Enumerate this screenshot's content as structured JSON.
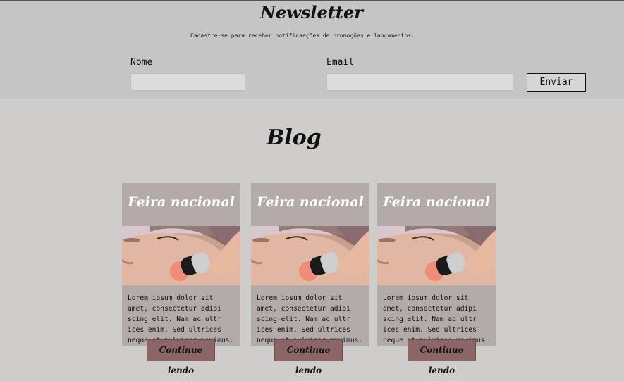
{
  "newsletter": {
    "title": "Newsletter",
    "subtitle": "Cadastre-se para receber notificaações de promoções e lançamentos.",
    "name_label": "Nome",
    "email_label": "Email",
    "name_value": "",
    "email_value": "",
    "submit_label": "Enviar"
  },
  "blog": {
    "title": "Blog",
    "posts": [
      {
        "title": "Feira nacional",
        "text": "Lorem ipsum dolor sit\namet, consectetur adipi\nscing elit. Nam ac ultr\nices enim. Sed ultrices\nneque et pulvinar maximus.",
        "image": "facial-treatment-photo",
        "button": "Continue lendo"
      },
      {
        "title": "Feira nacional",
        "text": "Lorem ipsum dolor sit\namet, consectetur adipi\nscing elit. Nam ac ultr\nices enim. Sed ultrices\nneque et pulvinar maximus.",
        "image": "facial-treatment-photo",
        "button": "Continue lendo"
      },
      {
        "title": "Feira nacional",
        "text": "Lorem ipsum dolor sit\namet, consectetur adipi\nscing elit. Nam ac ultr\nices enim. Sed ultrices\nneque et pulvinar maximus.",
        "image": "facial-treatment-photo",
        "button": "Continue lendo"
      }
    ]
  },
  "colors": {
    "newsletter_bg": "#c6c5c5",
    "page_bg": "#cfcdcc",
    "card_bg": "#b3aaaa",
    "button_bg": "#8c6666"
  }
}
